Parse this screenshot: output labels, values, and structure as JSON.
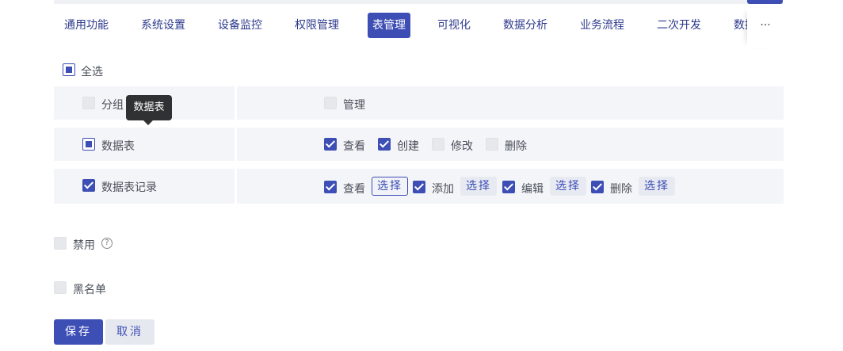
{
  "tabs": [
    "通用功能",
    "系统设置",
    "设备监控",
    "权限管理",
    "表管理",
    "可视化",
    "数据分析",
    "业务流程",
    "二次开发",
    "数据"
  ],
  "active_tab": "表管理",
  "tabs_more": "···",
  "select_all": "全选",
  "tooltip": "数据表",
  "rows": {
    "group": {
      "label": "分组",
      "perm_manage": "管理"
    },
    "table": {
      "label": "数据表",
      "perm_view": "查看",
      "perm_create": "创建",
      "perm_edit": "修改",
      "perm_delete": "删除"
    },
    "record": {
      "label": "数据表记录",
      "perm_view": "查看",
      "perm_add": "添加",
      "perm_edit": "编辑",
      "perm_delete": "删除",
      "select": "选择"
    }
  },
  "disable": {
    "label": "禁用",
    "help": "?"
  },
  "blacklist": {
    "label": "黑名单"
  },
  "buttons": {
    "save": "保存",
    "cancel": "取消"
  },
  "colors": {
    "accent": "#3d4eb5",
    "row_bg": "#f4f5f8"
  }
}
